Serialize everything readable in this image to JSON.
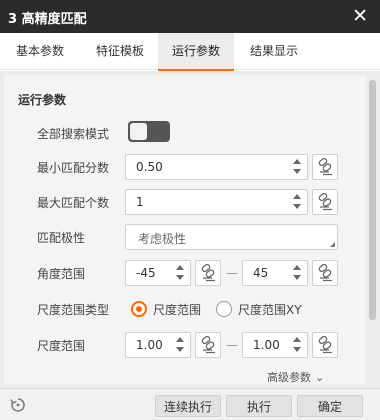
{
  "window": {
    "title": "3 高精度匹配"
  },
  "tabs": [
    {
      "label": "基本参数"
    },
    {
      "label": "特征模板"
    },
    {
      "label": "运行参数"
    },
    {
      "label": "结果显示"
    }
  ],
  "section": {
    "title": "运行参数"
  },
  "fields": {
    "search_all": {
      "label": "全部搜索模式",
      "checked": false
    },
    "min_score": {
      "label": "最小匹配分数",
      "value": "0.50"
    },
    "max_count": {
      "label": "最大匹配个数",
      "value": "1"
    },
    "polarity": {
      "label": "匹配极性",
      "value": "考虑极性"
    },
    "angle_range": {
      "label": "角度范围",
      "min": "-45",
      "max": "45"
    },
    "scale_type": {
      "label": "尺度范围类型",
      "options": [
        "尺度范围",
        "尺度范围XY"
      ],
      "selected": 0
    },
    "scale_range": {
      "label": "尺度范围",
      "min": "1.00",
      "max": "1.00"
    }
  },
  "advanced": {
    "label": "高级参数"
  },
  "buttons": {
    "continuous": "连续执行",
    "execute": "执行",
    "ok": "确定"
  },
  "colors": {
    "accent": "#ff6a00",
    "titlebar": "#2b2b2b"
  }
}
